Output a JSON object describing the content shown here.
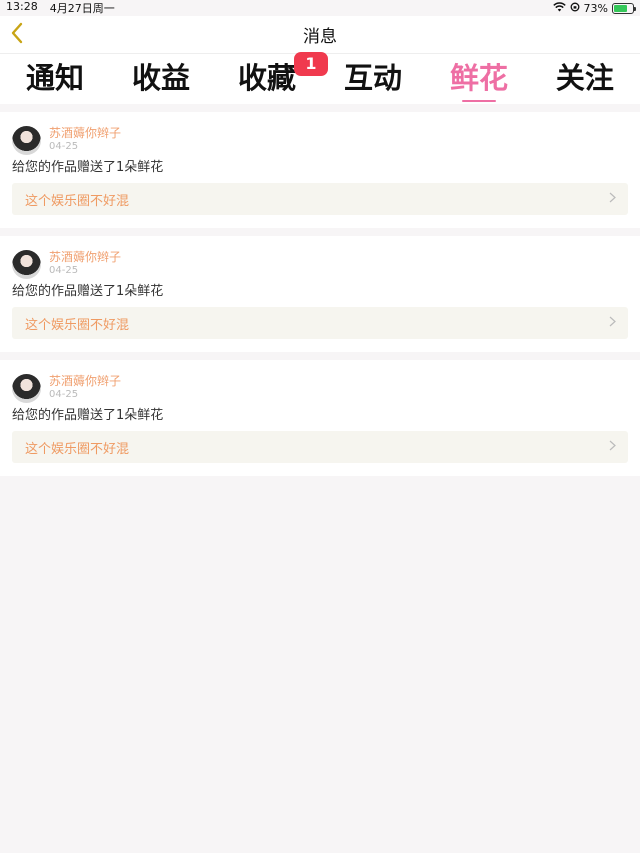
{
  "status": {
    "time": "13:28",
    "date": "4月27日周一",
    "battery": "73%"
  },
  "nav": {
    "title": "消息",
    "back_icon": "chevron-left-icon",
    "accent": "#c8a415"
  },
  "tabs": [
    {
      "label": "通知",
      "active": false
    },
    {
      "label": "收益",
      "active": false
    },
    {
      "label": "收藏",
      "active": false,
      "badge": "1"
    },
    {
      "label": "互动",
      "active": false
    },
    {
      "label": "鲜花",
      "active": true
    },
    {
      "label": "关注",
      "active": false
    }
  ],
  "colors": {
    "active_tab": "#ee6fa4",
    "badge": "#f03a4e",
    "username": "#f0a070",
    "work_title": "#ef9a62"
  },
  "items": [
    {
      "username": "苏酒薅你辫子",
      "date": "04-25",
      "message": "给您的作品赠送了1朵鲜花",
      "work_title": "这个娱乐圈不好混"
    },
    {
      "username": "苏酒薅你辫子",
      "date": "04-25",
      "message": "给您的作品赠送了1朵鲜花",
      "work_title": "这个娱乐圈不好混"
    },
    {
      "username": "苏酒薅你辫子",
      "date": "04-25",
      "message": "给您的作品赠送了1朵鲜花",
      "work_title": "这个娱乐圈不好混"
    }
  ]
}
